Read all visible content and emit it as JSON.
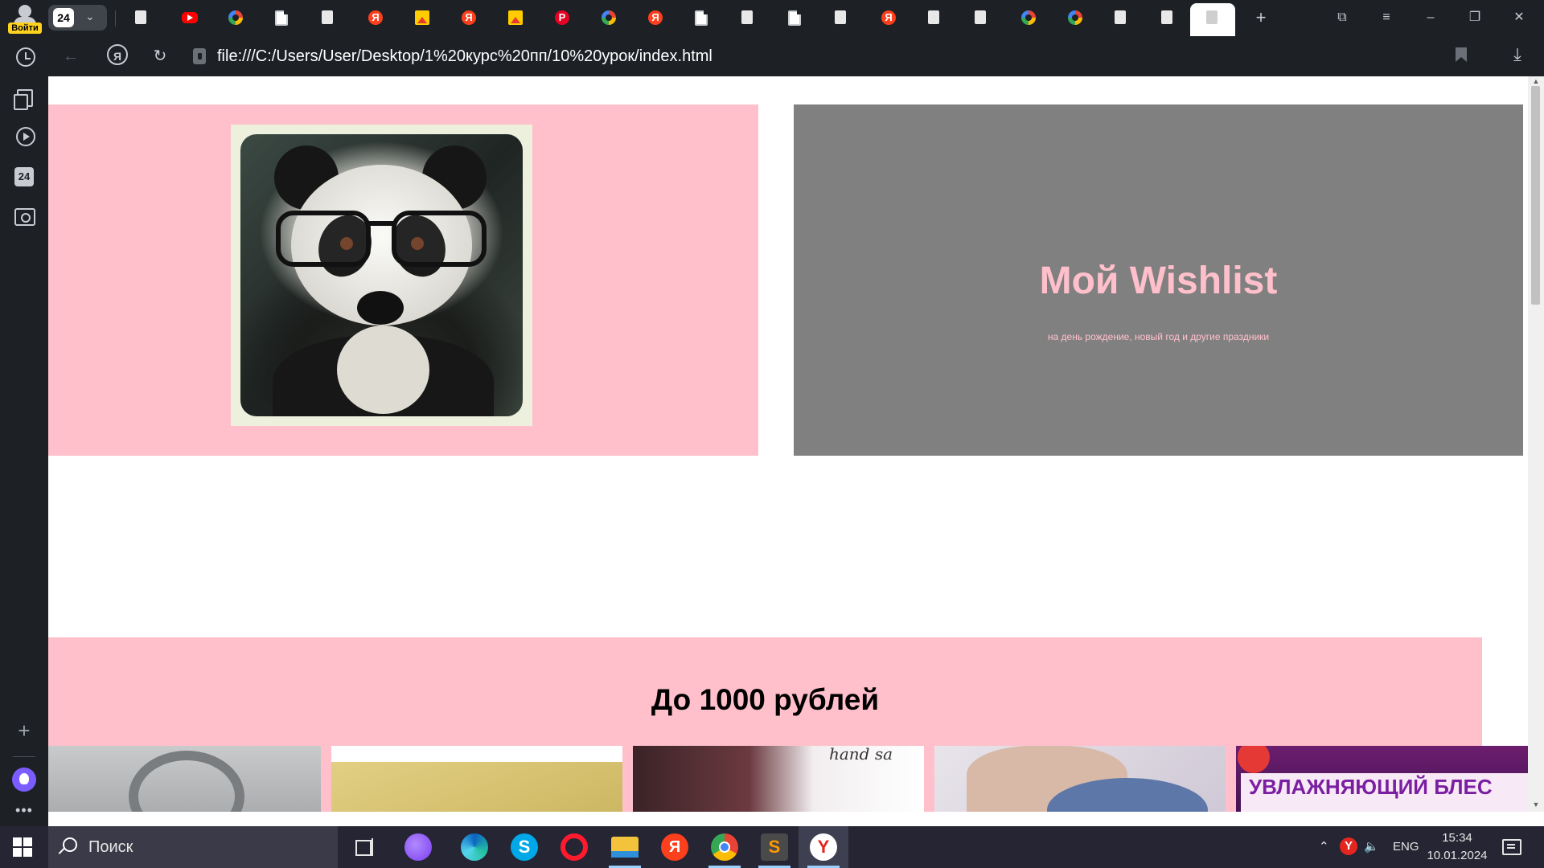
{
  "browser": {
    "profile_label": "Войти",
    "tab_group_count": "24",
    "address": "file:///C:/Users/User/Desktop/1%20курс%20пп/10%20урок/index.html",
    "tabs": [
      {
        "icon": "page-icon"
      },
      {
        "icon": "youtube-icon"
      },
      {
        "icon": "google-icon"
      },
      {
        "icon": "page-icon"
      },
      {
        "icon": "page-icon"
      },
      {
        "icon": "yandex-icon"
      },
      {
        "icon": "image-icon"
      },
      {
        "icon": "yandex-icon"
      },
      {
        "icon": "image-icon"
      },
      {
        "icon": "pinterest-icon"
      },
      {
        "icon": "google-icon"
      },
      {
        "icon": "yandex-icon"
      },
      {
        "icon": "page-icon"
      },
      {
        "icon": "page-icon"
      },
      {
        "icon": "page-icon"
      },
      {
        "icon": "page-icon"
      },
      {
        "icon": "yandex-icon"
      },
      {
        "icon": "page-icon"
      },
      {
        "icon": "page-icon"
      },
      {
        "icon": "google-icon"
      },
      {
        "icon": "google-icon"
      },
      {
        "icon": "page-icon"
      },
      {
        "icon": "page-icon"
      },
      {
        "icon": "page-icon",
        "active": true
      }
    ],
    "sidebar_badge": "24"
  },
  "page": {
    "wishlist_title": "Мой Wishlist",
    "wishlist_subtitle": "на день рождение, новый год и другие праздники",
    "section_title": "До 1000 рублей",
    "promo_text": "УВЛАЖНЯЮЩИЙ БЛЕС",
    "thumb3_script": "hand sa",
    "colors": {
      "pink": "#ffc0cb",
      "gray": "#808080"
    }
  },
  "taskbar": {
    "search_placeholder": "Поиск",
    "language": "ENG",
    "time": "15:34",
    "date": "10.01.2024",
    "skype_letter": "S",
    "yandex_letter": "Я",
    "ybrowser_letter": "Y"
  }
}
